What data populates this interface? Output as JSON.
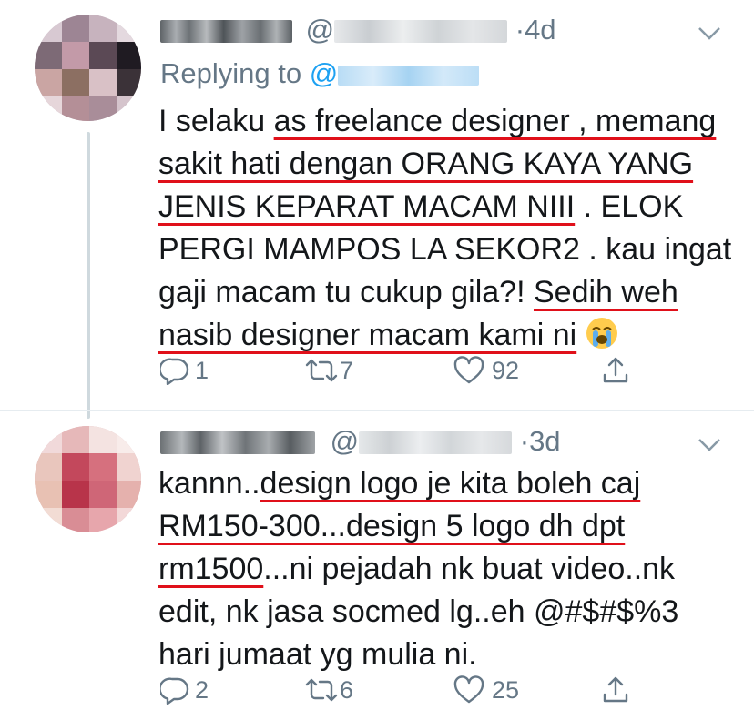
{
  "tweets": [
    {
      "timestamp": "4d",
      "at_sign": "@",
      "dot": "·",
      "replying_prefix": "Replying to",
      "replying_at": "@",
      "lines": [
        [
          {
            "t": "I selaku ",
            "u": false
          },
          {
            "t": "as freelance designer , memang",
            "u": true
          }
        ],
        [
          {
            "t": "sakit hati dengan ORANG KAYA YANG",
            "u": true
          }
        ],
        [
          {
            "t": "JENIS KEPARAT MACAM NIII",
            "u": true
          },
          {
            "t": " . ELOK",
            "u": false
          }
        ],
        [
          {
            "t": "PERGI MAMPOS LA SEKOR2 . kau ingat",
            "u": false
          }
        ],
        [
          {
            "t": "gaji macam tu cukup gila?! ",
            "u": false
          },
          {
            "t": "Sedih weh",
            "u": true
          }
        ],
        [
          {
            "t": "nasib designer macam kami ni",
            "u": true
          },
          {
            "t": " ",
            "u": false
          }
        ]
      ],
      "reply_count": "1",
      "retweet_count": "7",
      "like_count": "92"
    },
    {
      "timestamp": "3d",
      "at_sign": "@",
      "dot": "·",
      "lines": [
        [
          {
            "t": "kannn..",
            "u": false
          },
          {
            "t": "design logo je kita boleh caj",
            "u": true
          }
        ],
        [
          {
            "t": "RM150-300...design 5 logo dh dpt",
            "u": true
          }
        ],
        [
          {
            "t": "rm1500",
            "u": true
          },
          {
            "t": "...ni pejadah nk buat video..nk",
            "u": false
          }
        ],
        [
          {
            "t": "edit, nk jasa socmed lg..eh @#$#$%3",
            "u": false
          }
        ],
        [
          {
            "t": "hari jumaat yg mulia ni.",
            "u": false
          }
        ]
      ],
      "reply_count": "2",
      "retweet_count": "6",
      "like_count": "25"
    }
  ],
  "icons": {
    "reply": "reply-icon",
    "retweet": "retweet-icon",
    "like": "heart-icon",
    "share": "share-icon",
    "menu": "chevron-down-icon",
    "emoji": "loudly-crying-face-emoji"
  },
  "colors": {
    "text": "#14171a",
    "muted": "#657786",
    "link": "#1da1f2",
    "annotation_underline": "#e0101a",
    "thread_line": "#cfd9de"
  }
}
